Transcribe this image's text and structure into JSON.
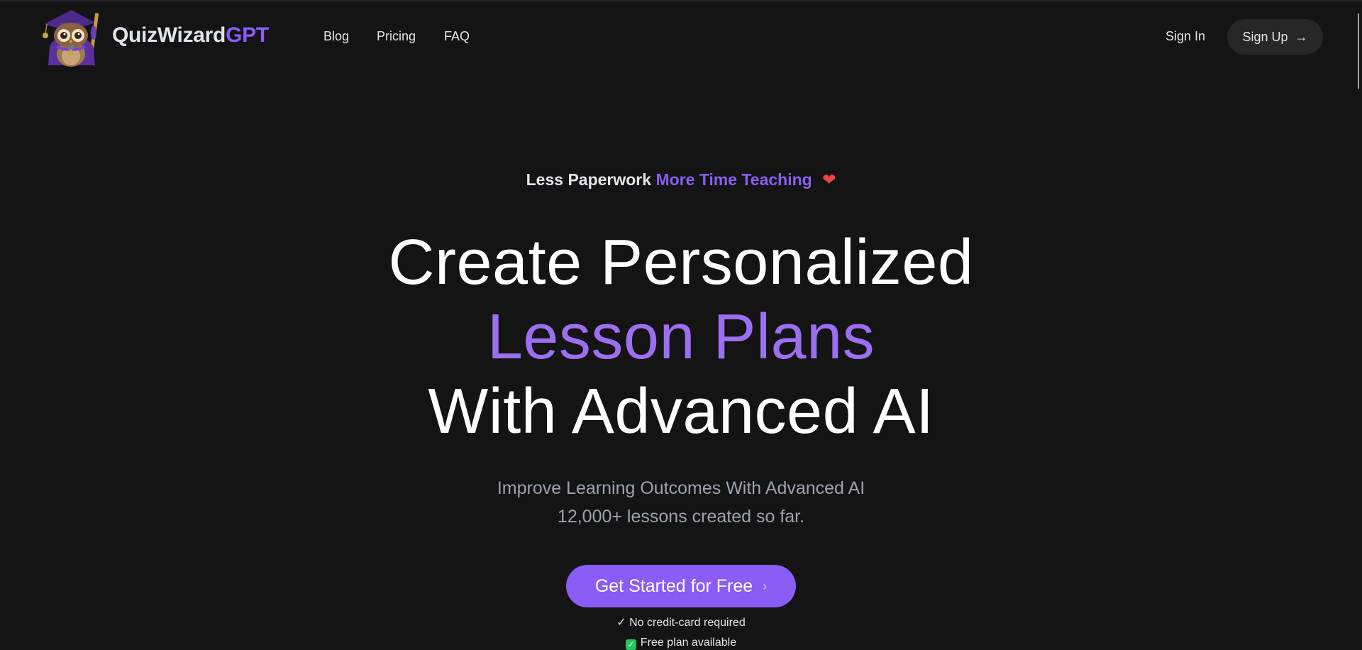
{
  "brand": {
    "name_main": "QuizWizard",
    "name_accent": "GPT",
    "logo": "owl-wizard-logo"
  },
  "nav": {
    "links": [
      {
        "label": "Blog"
      },
      {
        "label": "Pricing"
      },
      {
        "label": "FAQ"
      }
    ],
    "sign_in": "Sign In",
    "sign_up": "Sign Up",
    "sign_up_icon": "→"
  },
  "hero": {
    "eyebrow_main": "Less Paperwork",
    "eyebrow_accent": "More Time Teaching",
    "eyebrow_icon": "❤",
    "headline_line1": "Create Personalized",
    "headline_line2": "Lesson Plans",
    "headline_line3": "With Advanced AI",
    "subtitle_line1": "Improve Learning Outcomes With Advanced AI",
    "subtitle_line2": "12,000+ lessons created so far.",
    "cta_label": "Get Started for Free",
    "cta_icon": "›",
    "note1": "✓ No credit-card required",
    "note2_icon": "✓",
    "note2": "Free plan available"
  },
  "colors": {
    "background": "#141414",
    "accent": "#8b5cf6",
    "headline_accent": "#9b6ff0",
    "success": "#22c55e"
  }
}
